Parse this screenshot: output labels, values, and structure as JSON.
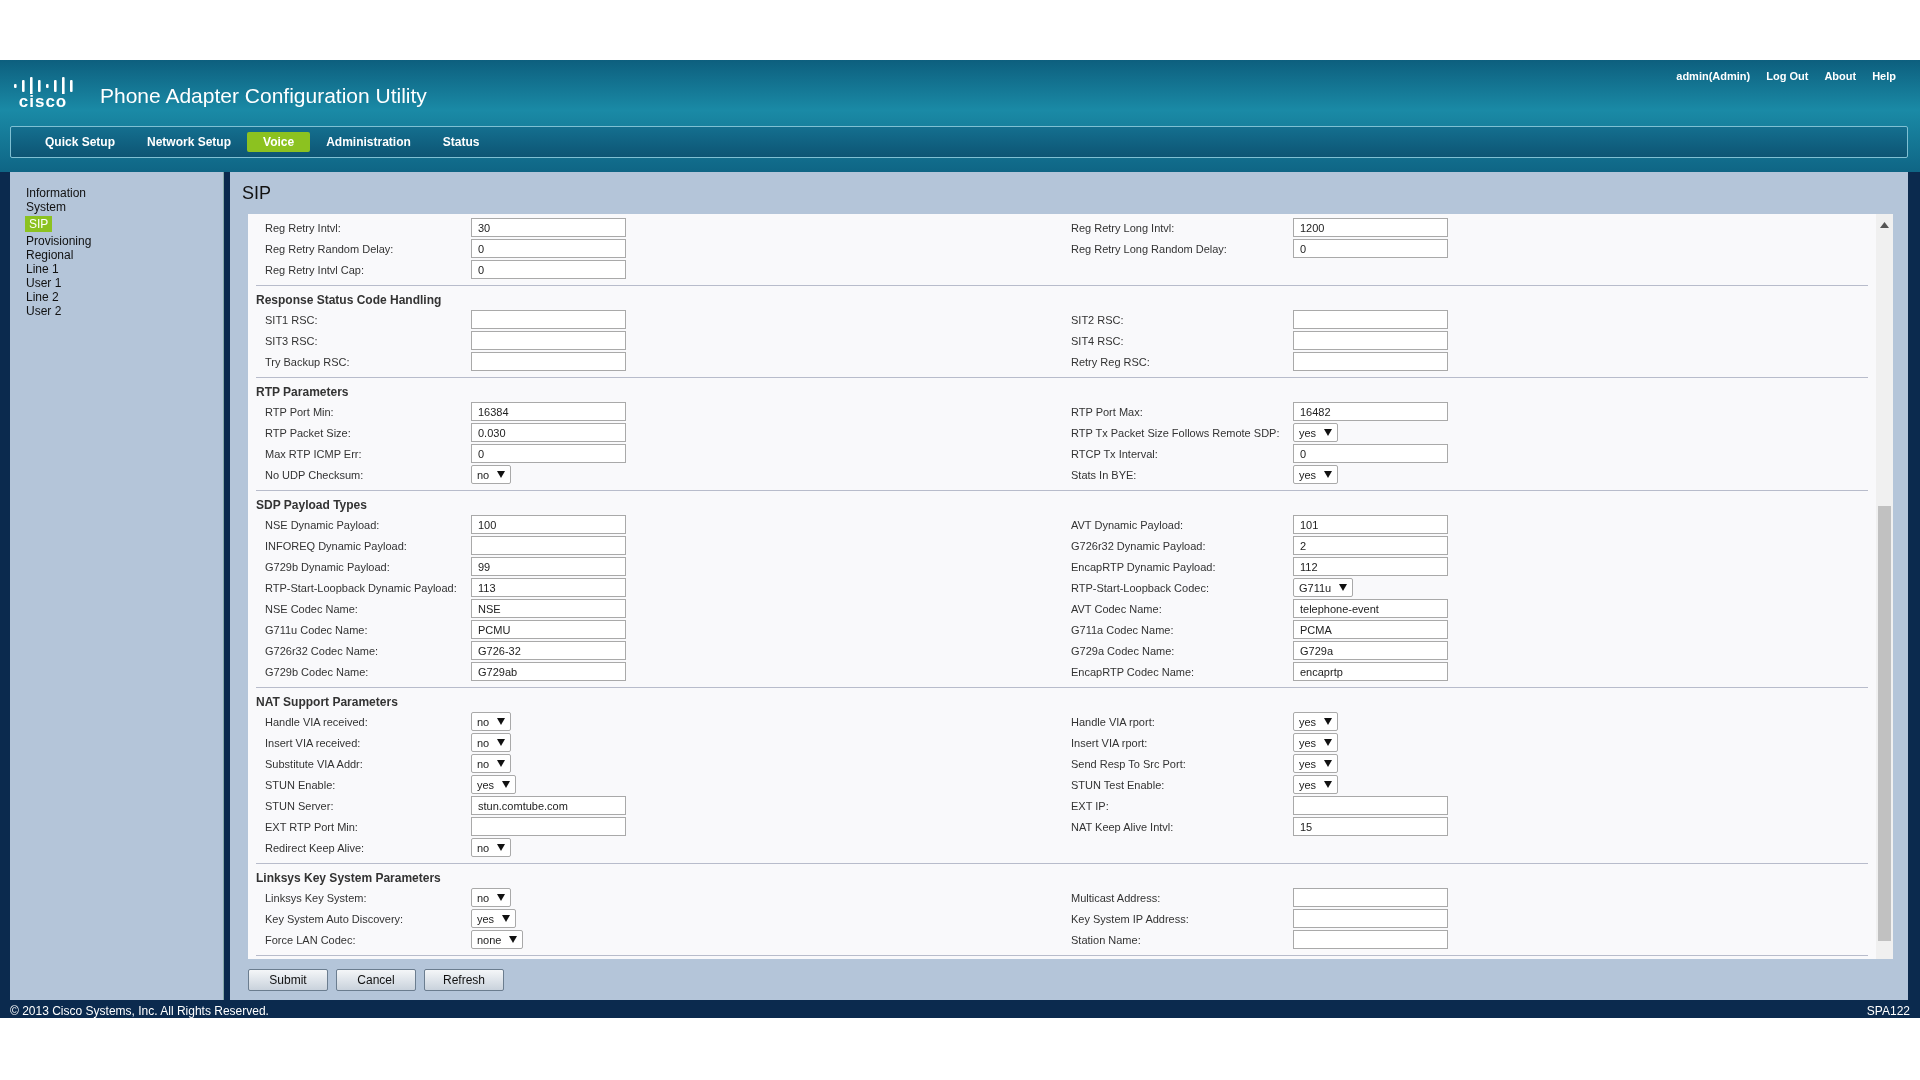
{
  "header": {
    "logo": "cisco",
    "title": "Phone Adapter Configuration Utility",
    "links": [
      "admin(Admin)",
      "Log Out",
      "About",
      "Help"
    ]
  },
  "nav": [
    {
      "label": "Quick Setup",
      "selected": false
    },
    {
      "label": "Network Setup",
      "selected": false
    },
    {
      "label": "Voice",
      "selected": true
    },
    {
      "label": "Administration",
      "selected": false
    },
    {
      "label": "Status",
      "selected": false
    }
  ],
  "sidebar": [
    {
      "label": "Information",
      "selected": false
    },
    {
      "label": "System",
      "selected": false
    },
    {
      "label": "SIP",
      "selected": true
    },
    {
      "label": "Provisioning",
      "selected": false
    },
    {
      "label": "Regional",
      "selected": false
    },
    {
      "label": "Line 1",
      "selected": false
    },
    {
      "label": "User 1",
      "selected": false
    },
    {
      "label": "Line 2",
      "selected": false
    },
    {
      "label": "User 2",
      "selected": false
    }
  ],
  "page_title": "SIP",
  "sections": [
    {
      "rows": [
        {
          "left": {
            "label": "Reg Retry Intvl:",
            "kind": "text",
            "value": "30"
          },
          "right": {
            "label": "Reg Retry Long Intvl:",
            "kind": "text",
            "value": "1200"
          }
        },
        {
          "left": {
            "label": "Reg Retry Random Delay:",
            "kind": "text",
            "value": "0"
          },
          "right": {
            "label": "Reg Retry Long Random Delay:",
            "kind": "text",
            "value": "0"
          }
        },
        {
          "left": {
            "label": "Reg Retry Intvl Cap:",
            "kind": "text",
            "value": "0"
          }
        }
      ]
    },
    {
      "title": "Response Status Code Handling",
      "rows": [
        {
          "left": {
            "label": "SIT1 RSC:",
            "kind": "text"
          },
          "right": {
            "label": "SIT2 RSC:",
            "kind": "text"
          }
        },
        {
          "left": {
            "label": "SIT3 RSC:",
            "kind": "text"
          },
          "right": {
            "label": "SIT4 RSC:",
            "kind": "text"
          }
        },
        {
          "left": {
            "label": "Try Backup RSC:",
            "kind": "text"
          },
          "right": {
            "label": "Retry Reg RSC:",
            "kind": "text"
          }
        }
      ]
    },
    {
      "title": "RTP Parameters",
      "rows": [
        {
          "left": {
            "label": "RTP Port Min:",
            "kind": "text",
            "value": "16384"
          },
          "right": {
            "label": "RTP Port Max:",
            "kind": "text",
            "value": "16482"
          }
        },
        {
          "left": {
            "label": "RTP Packet Size:",
            "kind": "text",
            "value": "0.030"
          },
          "right": {
            "label": "RTP Tx Packet Size Follows Remote SDP:",
            "kind": "select",
            "value": "yes"
          }
        },
        {
          "left": {
            "label": "Max RTP ICMP Err:",
            "kind": "text",
            "value": "0"
          },
          "right": {
            "label": "RTCP Tx Interval:",
            "kind": "text",
            "value": "0"
          }
        },
        {
          "left": {
            "label": "No UDP Checksum:",
            "kind": "select",
            "value": "no"
          },
          "right": {
            "label": "Stats In BYE:",
            "kind": "select",
            "value": "yes"
          }
        }
      ]
    },
    {
      "title": "SDP Payload Types",
      "rows": [
        {
          "left": {
            "label": "NSE Dynamic Payload:",
            "kind": "text",
            "value": "100"
          },
          "right": {
            "label": "AVT Dynamic Payload:",
            "kind": "text",
            "value": "101"
          }
        },
        {
          "left": {
            "label": "INFOREQ Dynamic Payload:",
            "kind": "text"
          },
          "right": {
            "label": "G726r32 Dynamic Payload:",
            "kind": "text",
            "value": "2"
          }
        },
        {
          "left": {
            "label": "G729b Dynamic Payload:",
            "kind": "text",
            "value": "99"
          },
          "right": {
            "label": "EncapRTP Dynamic Payload:",
            "kind": "text",
            "value": "112"
          }
        },
        {
          "left": {
            "label": "RTP-Start-Loopback Dynamic Payload:",
            "kind": "text",
            "value": "113"
          },
          "right": {
            "label": "RTP-Start-Loopback Codec:",
            "kind": "select",
            "value": "G711u"
          }
        },
        {
          "left": {
            "label": "NSE Codec Name:",
            "kind": "text",
            "value": "NSE"
          },
          "right": {
            "label": "AVT Codec Name:",
            "kind": "text",
            "value": "telephone-event"
          }
        },
        {
          "left": {
            "label": "G711u Codec Name:",
            "kind": "text",
            "value": "PCMU"
          },
          "right": {
            "label": "G711a Codec Name:",
            "kind": "text",
            "value": "PCMA"
          }
        },
        {
          "left": {
            "label": "G726r32 Codec Name:",
            "kind": "text",
            "value": "G726-32"
          },
          "right": {
            "label": "G729a Codec Name:",
            "kind": "text",
            "value": "G729a"
          }
        },
        {
          "left": {
            "label": "G729b Codec Name:",
            "kind": "text",
            "value": "G729ab"
          },
          "right": {
            "label": "EncapRTP Codec Name:",
            "kind": "text",
            "value": "encaprtp"
          }
        }
      ]
    },
    {
      "title": "NAT Support Parameters",
      "rows": [
        {
          "left": {
            "label": "Handle VIA received:",
            "kind": "select",
            "value": "no"
          },
          "right": {
            "label": "Handle VIA rport:",
            "kind": "select",
            "value": "yes"
          }
        },
        {
          "left": {
            "label": "Insert VIA received:",
            "kind": "select",
            "value": "no"
          },
          "right": {
            "label": "Insert VIA rport:",
            "kind": "select",
            "value": "yes"
          }
        },
        {
          "left": {
            "label": "Substitute VIA Addr:",
            "kind": "select",
            "value": "no"
          },
          "right": {
            "label": "Send Resp To Src Port:",
            "kind": "select",
            "value": "yes"
          }
        },
        {
          "left": {
            "label": "STUN Enable:",
            "kind": "select",
            "value": "yes"
          },
          "right": {
            "label": "STUN Test Enable:",
            "kind": "select",
            "value": "yes"
          }
        },
        {
          "left": {
            "label": "STUN Server:",
            "kind": "text",
            "value": "stun.comtube.com"
          },
          "right": {
            "label": "EXT IP:",
            "kind": "text"
          }
        },
        {
          "left": {
            "label": "EXT RTP Port Min:",
            "kind": "text"
          },
          "right": {
            "label": "NAT Keep Alive Intvl:",
            "kind": "text",
            "value": "15"
          }
        },
        {
          "left": {
            "label": "Redirect Keep Alive:",
            "kind": "select",
            "value": "no"
          }
        }
      ]
    },
    {
      "title": "Linksys Key System Parameters",
      "rows": [
        {
          "left": {
            "label": "Linksys Key System:",
            "kind": "select",
            "value": "no"
          },
          "right": {
            "label": "Multicast Address:",
            "kind": "text"
          }
        },
        {
          "left": {
            "label": "Key System Auto Discovery:",
            "kind": "select",
            "value": "yes"
          },
          "right": {
            "label": "Key System IP Address:",
            "kind": "text"
          }
        },
        {
          "left": {
            "label": "Force LAN Codec:",
            "kind": "select",
            "value": "none"
          },
          "right": {
            "label": "Station Name:",
            "kind": "text"
          }
        }
      ]
    }
  ],
  "buttons": [
    "Submit",
    "Cancel",
    "Refresh"
  ],
  "footer": {
    "copyright": "© 2013 Cisco Systems, Inc. All Rights Reserved.",
    "model": "SPA122"
  }
}
